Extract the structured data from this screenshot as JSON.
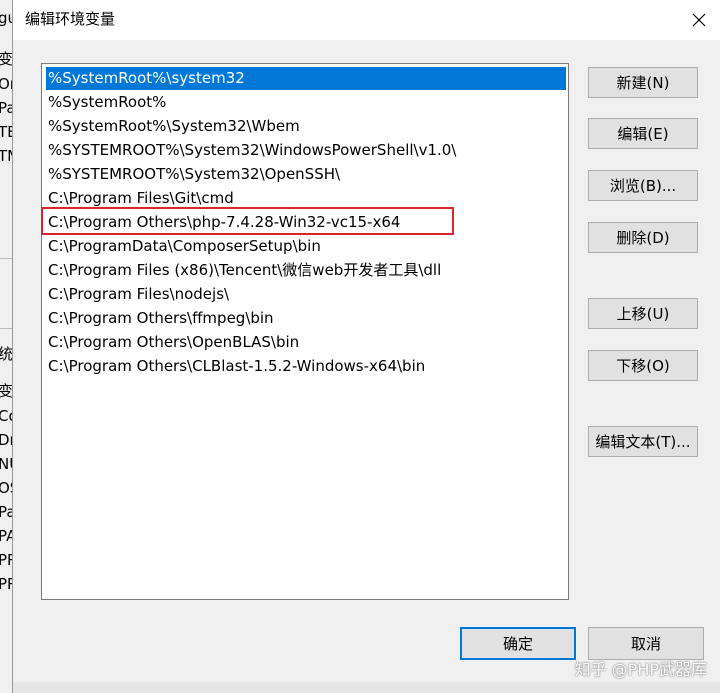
{
  "background_window": {
    "fragments": [
      "gu",
      "变量",
      "On",
      "Pat",
      "TEI",
      "TM",
      "统变",
      "变量",
      "Co",
      "Dri",
      "NU",
      "OS",
      "Pat",
      "PA",
      "PR",
      "PR"
    ]
  },
  "dialog": {
    "title": "编辑环境变量",
    "close_icon": "close-icon"
  },
  "path_list": {
    "selected_index": 0,
    "highlighted_index": 5,
    "items": [
      "%SystemRoot%\\system32",
      "%SystemRoot%",
      "%SystemRoot%\\System32\\Wbem",
      "%SYSTEMROOT%\\System32\\WindowsPowerShell\\v1.0\\",
      "%SYSTEMROOT%\\System32\\OpenSSH\\",
      "C:\\Program Files\\Git\\cmd",
      "C:\\Program Others\\php-7.4.28-Win32-vc15-x64",
      "C:\\ProgramData\\ComposerSetup\\bin",
      "C:\\Program Files (x86)\\Tencent\\微信web开发者工具\\dll",
      "C:\\Program Files\\nodejs\\",
      "C:\\Program Others\\ffmpeg\\bin",
      "C:\\Program Others\\OpenBLAS\\bin",
      "C:\\Program Others\\CLBlast-1.5.2-Windows-x64\\bin"
    ]
  },
  "buttons": {
    "new": "新建(N)",
    "edit": "编辑(E)",
    "browse": "浏览(B)...",
    "delete": "删除(D)",
    "move_up": "上移(U)",
    "move_down": "下移(O)",
    "edit_text": "编辑文本(T)...",
    "ok": "确定",
    "cancel": "取消"
  },
  "watermark": "知乎 @PHP武器库",
  "colors": {
    "selection": "#0078d7",
    "highlight_border": "#d9262e"
  }
}
